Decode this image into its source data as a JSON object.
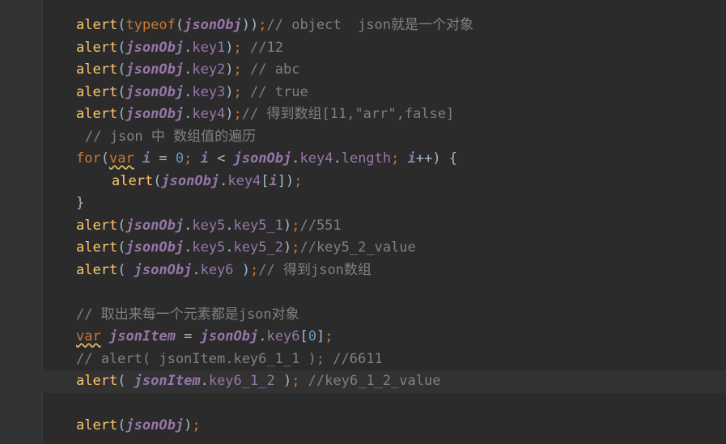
{
  "editor": {
    "lines": [
      {
        "segments": [
          {
            "t": "alert",
            "c": "fn"
          },
          {
            "t": "(",
            "c": "op"
          },
          {
            "t": "typeof",
            "c": "kw"
          },
          {
            "t": "(",
            "c": "op"
          },
          {
            "t": "jsonObj",
            "c": "var"
          },
          {
            "t": "))",
            "c": "op"
          },
          {
            "t": ";",
            "c": "pun"
          },
          {
            "t": "// object  json就是一个对象",
            "c": "cmt"
          }
        ]
      },
      {
        "segments": [
          {
            "t": "alert",
            "c": "fn"
          },
          {
            "t": "(",
            "c": "op"
          },
          {
            "t": "jsonObj",
            "c": "var"
          },
          {
            "t": ".",
            "c": "op"
          },
          {
            "t": "key1",
            "c": "prop"
          },
          {
            "t": ")",
            "c": "op"
          },
          {
            "t": "; ",
            "c": "pun"
          },
          {
            "t": "//12",
            "c": "cmt"
          }
        ]
      },
      {
        "segments": [
          {
            "t": "alert",
            "c": "fn"
          },
          {
            "t": "(",
            "c": "op"
          },
          {
            "t": "jsonObj",
            "c": "var"
          },
          {
            "t": ".",
            "c": "op"
          },
          {
            "t": "key2",
            "c": "prop"
          },
          {
            "t": ")",
            "c": "op"
          },
          {
            "t": "; ",
            "c": "pun"
          },
          {
            "t": "// abc",
            "c": "cmt"
          }
        ]
      },
      {
        "segments": [
          {
            "t": "alert",
            "c": "fn"
          },
          {
            "t": "(",
            "c": "op"
          },
          {
            "t": "jsonObj",
            "c": "var"
          },
          {
            "t": ".",
            "c": "op"
          },
          {
            "t": "key3",
            "c": "prop"
          },
          {
            "t": ")",
            "c": "op"
          },
          {
            "t": "; ",
            "c": "pun"
          },
          {
            "t": "// true",
            "c": "cmt"
          }
        ]
      },
      {
        "segments": [
          {
            "t": "alert",
            "c": "fn"
          },
          {
            "t": "(",
            "c": "op"
          },
          {
            "t": "jsonObj",
            "c": "var"
          },
          {
            "t": ".",
            "c": "op"
          },
          {
            "t": "key4",
            "c": "prop"
          },
          {
            "t": ")",
            "c": "op"
          },
          {
            "t": ";",
            "c": "pun"
          },
          {
            "t": "// 得到数组[11,\"arr\",false]",
            "c": "cmt"
          }
        ]
      },
      {
        "indent": "c",
        "segments": [
          {
            "t": "// json 中 数组值的遍历",
            "c": "cmt"
          }
        ]
      },
      {
        "segments": [
          {
            "t": "for",
            "c": "kw"
          },
          {
            "t": "(",
            "c": "op"
          },
          {
            "t": "var",
            "c": "kw wavy"
          },
          {
            "t": " ",
            "c": "op"
          },
          {
            "t": "i",
            "c": "var"
          },
          {
            "t": " = ",
            "c": "op"
          },
          {
            "t": "0",
            "c": "num"
          },
          {
            "t": "; ",
            "c": "pun"
          },
          {
            "t": "i",
            "c": "var"
          },
          {
            "t": " < ",
            "c": "op"
          },
          {
            "t": "jsonObj",
            "c": "var"
          },
          {
            "t": ".",
            "c": "op"
          },
          {
            "t": "key4",
            "c": "prop"
          },
          {
            "t": ".",
            "c": "op"
          },
          {
            "t": "length",
            "c": "prop"
          },
          {
            "t": "; ",
            "c": "pun"
          },
          {
            "t": "i",
            "c": "var"
          },
          {
            "t": "++) {",
            "c": "op"
          }
        ]
      },
      {
        "indent": "2",
        "segments": [
          {
            "t": "alert",
            "c": "fn"
          },
          {
            "t": "(",
            "c": "op"
          },
          {
            "t": "jsonObj",
            "c": "var"
          },
          {
            "t": ".",
            "c": "op"
          },
          {
            "t": "key4",
            "c": "prop"
          },
          {
            "t": "[",
            "c": "op"
          },
          {
            "t": "i",
            "c": "var"
          },
          {
            "t": "])",
            "c": "op"
          },
          {
            "t": ";",
            "c": "pun"
          }
        ]
      },
      {
        "segments": [
          {
            "t": "}",
            "c": "op"
          }
        ]
      },
      {
        "segments": [
          {
            "t": "alert",
            "c": "fn"
          },
          {
            "t": "(",
            "c": "op"
          },
          {
            "t": "jsonObj",
            "c": "var"
          },
          {
            "t": ".",
            "c": "op"
          },
          {
            "t": "key5",
            "c": "prop"
          },
          {
            "t": ".",
            "c": "op"
          },
          {
            "t": "key5_1",
            "c": "prop"
          },
          {
            "t": ")",
            "c": "op"
          },
          {
            "t": ";",
            "c": "pun"
          },
          {
            "t": "//551",
            "c": "cmt"
          }
        ]
      },
      {
        "segments": [
          {
            "t": "alert",
            "c": "fn"
          },
          {
            "t": "(",
            "c": "op"
          },
          {
            "t": "jsonObj",
            "c": "var"
          },
          {
            "t": ".",
            "c": "op"
          },
          {
            "t": "key5",
            "c": "prop"
          },
          {
            "t": ".",
            "c": "op"
          },
          {
            "t": "key5_2",
            "c": "prop"
          },
          {
            "t": ")",
            "c": "op"
          },
          {
            "t": ";",
            "c": "pun"
          },
          {
            "t": "//key5_2_value",
            "c": "cmt"
          }
        ]
      },
      {
        "segments": [
          {
            "t": "alert",
            "c": "fn"
          },
          {
            "t": "( ",
            "c": "op"
          },
          {
            "t": "jsonObj",
            "c": "var"
          },
          {
            "t": ".",
            "c": "op"
          },
          {
            "t": "key6",
            "c": "prop"
          },
          {
            "t": " )",
            "c": "op"
          },
          {
            "t": ";",
            "c": "pun"
          },
          {
            "t": "// 得到json数组",
            "c": "cmt"
          }
        ]
      },
      {
        "segments": []
      },
      {
        "segments": [
          {
            "t": "// 取出来每一个元素都是json对象",
            "c": "cmt"
          }
        ]
      },
      {
        "segments": [
          {
            "t": "var",
            "c": "kw wavy"
          },
          {
            "t": " ",
            "c": "op"
          },
          {
            "t": "jsonItem",
            "c": "var"
          },
          {
            "t": " = ",
            "c": "op"
          },
          {
            "t": "jsonObj",
            "c": "var"
          },
          {
            "t": ".",
            "c": "op"
          },
          {
            "t": "key6",
            "c": "prop"
          },
          {
            "t": "[",
            "c": "op"
          },
          {
            "t": "0",
            "c": "num"
          },
          {
            "t": "]",
            "c": "op"
          },
          {
            "t": ";",
            "c": "pun"
          }
        ]
      },
      {
        "segments": [
          {
            "t": "// alert( jsonItem.key6_1_1 ); //6611",
            "c": "cmt"
          }
        ]
      },
      {
        "current": true,
        "segments": [
          {
            "t": "alert",
            "c": "fn"
          },
          {
            "t": "( ",
            "c": "op"
          },
          {
            "t": "jsonItem",
            "c": "var"
          },
          {
            "t": ".",
            "c": "op"
          },
          {
            "t": "key6_1_2",
            "c": "prop"
          },
          {
            "t": " )",
            "c": "op"
          },
          {
            "t": "; ",
            "c": "pun"
          },
          {
            "t": "//key6_1_2_value",
            "c": "cmt"
          }
        ]
      },
      {
        "segments": []
      },
      {
        "segments": [
          {
            "t": "alert",
            "c": "fn"
          },
          {
            "t": "(",
            "c": "op"
          },
          {
            "t": "jsonObj",
            "c": "var"
          },
          {
            "t": ")",
            "c": "op"
          },
          {
            "t": ";",
            "c": "pun"
          }
        ]
      }
    ]
  },
  "colors": {
    "background": "#2b2b2b",
    "gutter": "#313335",
    "current_line": "#323232",
    "function": "#ffc66d",
    "keyword": "#cc7832",
    "variable": "#9876aa",
    "number": "#6897bb",
    "comment": "#808080",
    "default_text": "#a9b7c6"
  }
}
